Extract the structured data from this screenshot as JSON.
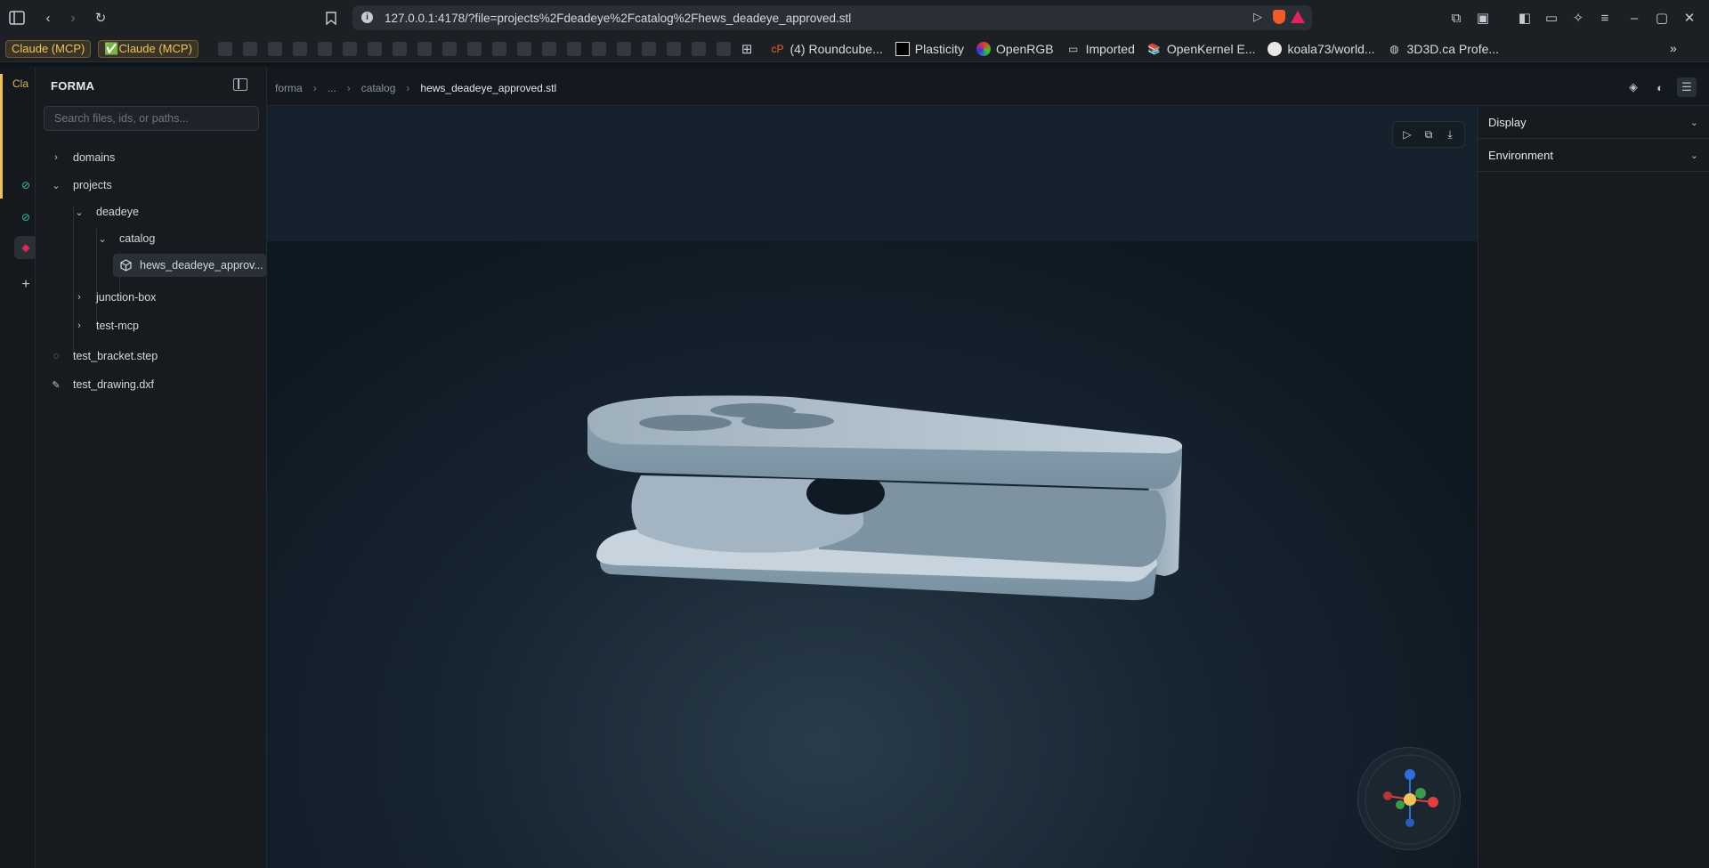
{
  "browser": {
    "url": "127.0.0.1:4178/?file=projects%2Fdeadeye%2Fcatalog%2Fhews_deadeye_approved.stl",
    "bookmarks": [
      {
        "label": "Claude (MCP)",
        "icon": "claude-badge"
      },
      {
        "label": "✅Claude (MCP)",
        "icon": "claude-badge"
      }
    ],
    "bookmark_links": [
      {
        "label": "(4) Roundcube...",
        "icon": "roundcube-icon"
      },
      {
        "label": "Plasticity",
        "icon": "plasticity-icon"
      },
      {
        "label": "OpenRGB",
        "icon": "openrgb-icon"
      },
      {
        "label": "Imported",
        "icon": "folder-icon"
      },
      {
        "label": "OpenKernel E...",
        "icon": "book-icon"
      },
      {
        "label": "koala73/world...",
        "icon": "github-icon"
      },
      {
        "label": "3D3D.ca Profe...",
        "icon": "globe-icon"
      }
    ],
    "rail_label": "Cla"
  },
  "sidebar": {
    "title": "FORMA",
    "search_placeholder": "Search files, ids, or paths...",
    "tree": {
      "domains": "domains",
      "projects": "projects",
      "deadeye": "deadeye",
      "catalog": "catalog",
      "file_selected": "hews_deadeye_approv...",
      "junction_box": "junction-box",
      "test_mcp": "test-mcp",
      "test_bracket": "test_bracket.step",
      "test_drawing": "test_drawing.dxf"
    }
  },
  "header": {
    "breadcrumb": {
      "root": "forma",
      "ellipsis": "...",
      "folder": "catalog",
      "current": "hews_deadeye_approved.stl"
    }
  },
  "right_panel": {
    "display": "Display",
    "environment": "Environment"
  },
  "colors": {
    "accent_gold": "#f0c25a",
    "model_surface": "#a9bac6",
    "gizmo_x": "#e04040",
    "gizmo_y": "#3a9b4a",
    "gizmo_z": "#2f6fd8"
  }
}
